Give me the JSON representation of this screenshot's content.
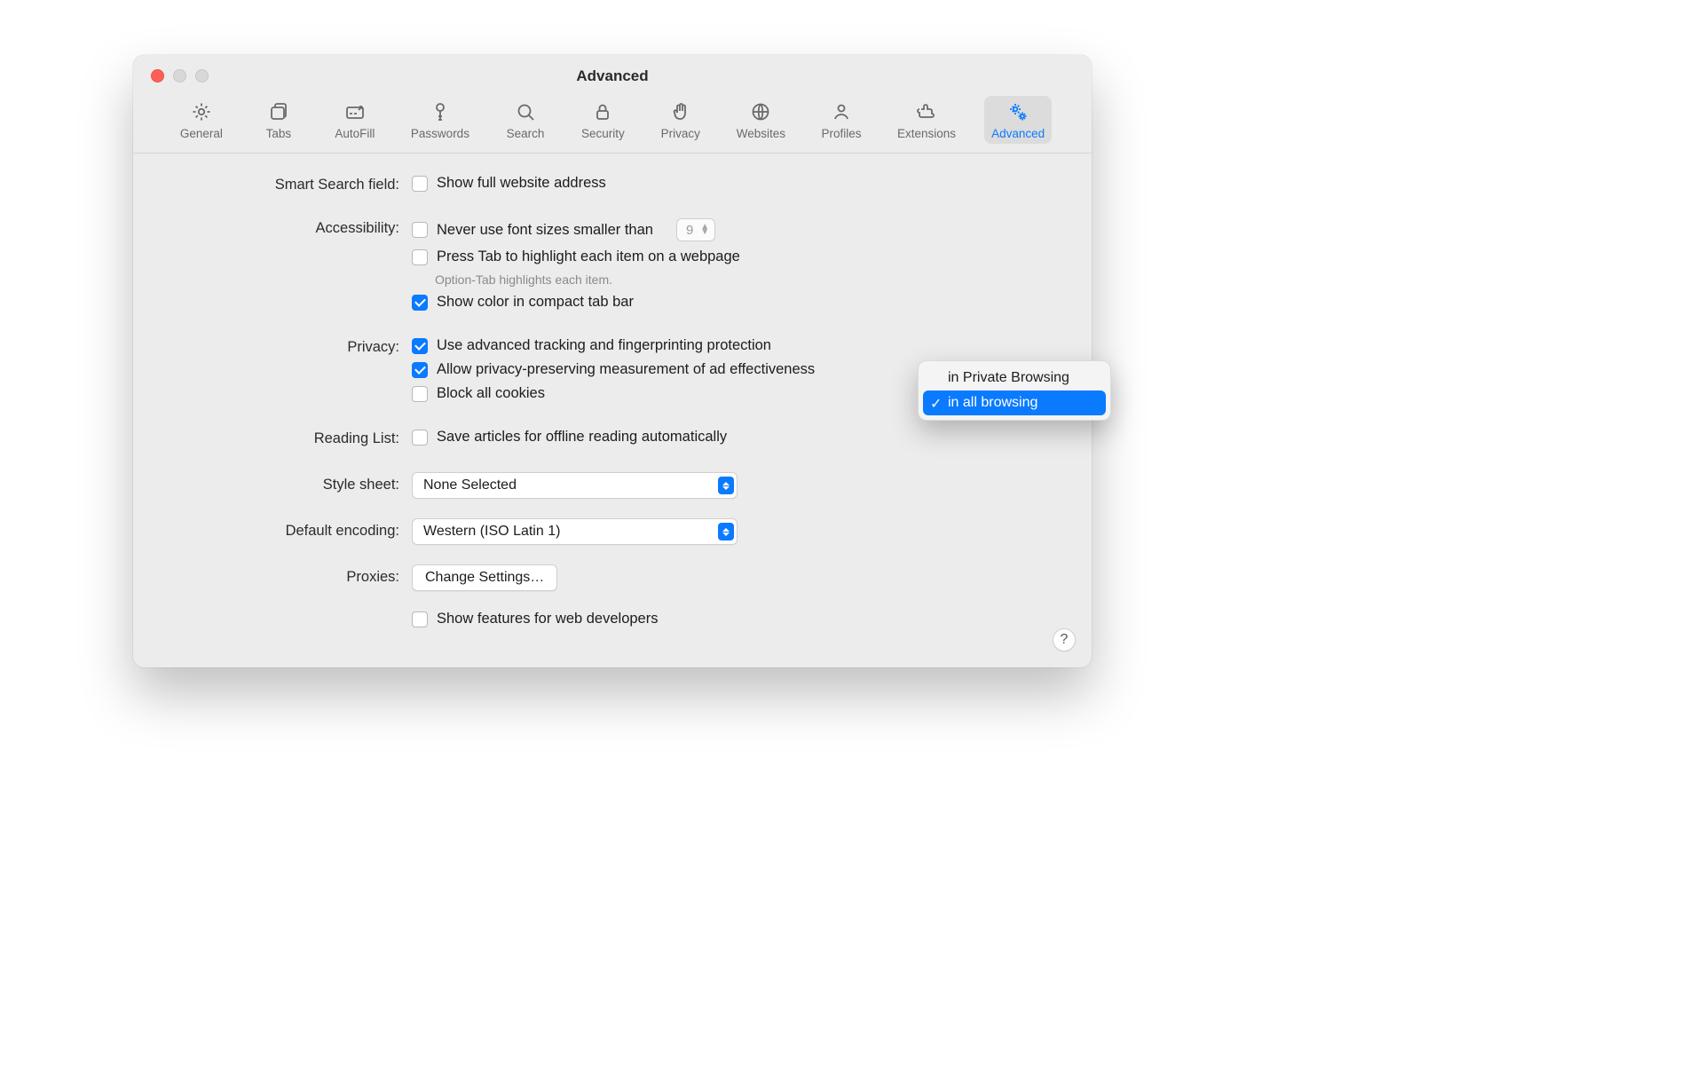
{
  "window": {
    "title": "Advanced"
  },
  "toolbar": {
    "items": [
      {
        "label": "General"
      },
      {
        "label": "Tabs"
      },
      {
        "label": "AutoFill"
      },
      {
        "label": "Passwords"
      },
      {
        "label": "Search"
      },
      {
        "label": "Security"
      },
      {
        "label": "Privacy"
      },
      {
        "label": "Websites"
      },
      {
        "label": "Profiles"
      },
      {
        "label": "Extensions"
      },
      {
        "label": "Advanced"
      }
    ]
  },
  "sections": {
    "smart_search": {
      "label": "Smart Search field:",
      "show_full_url": "Show full website address"
    },
    "accessibility": {
      "label": "Accessibility:",
      "min_font": "Never use font sizes smaller than",
      "min_font_value": "9",
      "press_tab": "Press Tab to highlight each item on a webpage",
      "hint": "Option-Tab highlights each item.",
      "compact_color": "Show color in compact tab bar"
    },
    "privacy": {
      "label": "Privacy:",
      "tracking": "Use advanced tracking and fingerprinting protection",
      "ad_measure": "Allow privacy-preserving measurement of ad effectiveness",
      "block_cookies": "Block all cookies"
    },
    "reading_list": {
      "label": "Reading List:",
      "offline": "Save articles for offline reading automatically"
    },
    "style_sheet": {
      "label": "Style sheet:",
      "value": "None Selected"
    },
    "encoding": {
      "label": "Default encoding:",
      "value": "Western (ISO Latin 1)"
    },
    "proxies": {
      "label": "Proxies:",
      "button": "Change Settings…"
    },
    "dev": {
      "label": "Show features for web developers"
    }
  },
  "dropdown_menu": {
    "options": [
      "in Private Browsing",
      "in all browsing"
    ],
    "selected_index": 1
  },
  "help_glyph": "?"
}
